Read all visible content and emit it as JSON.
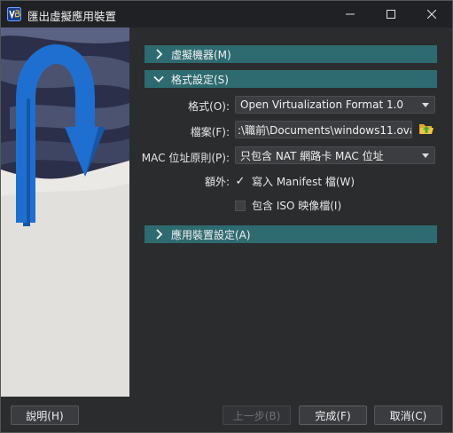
{
  "window": {
    "title": "匯出虛擬應用裝置"
  },
  "sections": {
    "vm": {
      "label": "虛擬機器(M)",
      "expanded": false
    },
    "format": {
      "label": "格式設定(S)",
      "expanded": true
    },
    "appliance": {
      "label": "應用裝置設定(A)",
      "expanded": false
    }
  },
  "form": {
    "format_label": "格式(O):",
    "format_value": "Open Virtualization Format 1.0",
    "file_label": "檔案(F):",
    "file_value": ":\\職前\\Documents\\windows11.ova",
    "mac_label": "MAC 位址原則(P):",
    "mac_value": "只包含 NAT 網路卡 MAC 位址",
    "extra_label": "額外:",
    "manifest_label": "寫入 Manifest 檔(W)",
    "manifest_checked": true,
    "iso_label": "包含 ISO 映像檔(I)",
    "iso_checked": false
  },
  "buttons": {
    "help": "說明(H)",
    "back": "上一步(B)",
    "finish": "完成(F)",
    "cancel": "取消(C)"
  },
  "colors": {
    "section_header": "#2e6b70",
    "titlebar": "#202124",
    "background": "#2b2c2e",
    "arrow_blue": "#1f6fd1"
  },
  "icons": {
    "app": "virtualbox-icon",
    "folder": "folder-open-icon"
  }
}
